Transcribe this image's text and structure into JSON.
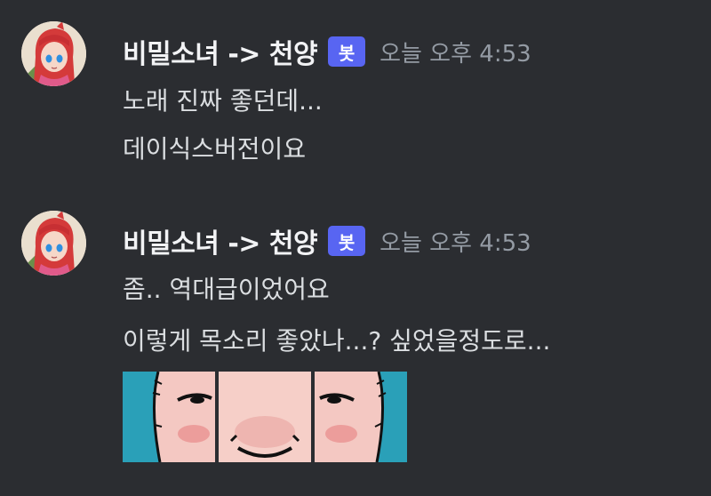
{
  "messages": [
    {
      "author": "비밀소녀 -> 천양",
      "badge": "봇",
      "timestamp": "오늘 오후 4:53",
      "lines": [
        "노래 진짜 좋던데...",
        "데이식스버전이요"
      ]
    },
    {
      "author": "비밀소녀 -> 천양",
      "badge": "봇",
      "timestamp": "오늘 오후 4:53",
      "lines": [
        "좀.. 역대급이었어요",
        "이렇게 목소리 좋았나...? 싶었을정도로..."
      ]
    }
  ],
  "sticker": {
    "panels": 3
  },
  "colors": {
    "background": "#2b2d31",
    "username": "#f2f3f5",
    "badge": "#5865f2",
    "timestamp": "#949ba4",
    "text": "#dbdee1"
  }
}
